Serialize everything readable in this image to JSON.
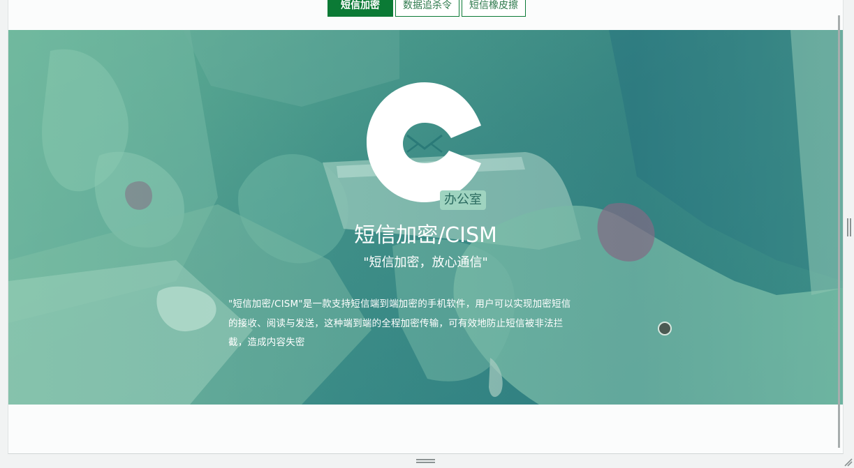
{
  "tabs": [
    {
      "label": "短信加密",
      "active": true
    },
    {
      "label": "数据追杀令",
      "active": false
    },
    {
      "label": "短信橡皮擦",
      "active": false
    }
  ],
  "hero": {
    "title": "短信加密/CISM",
    "subtitle": "\"短信加密，放心通信\"",
    "description_lines": [
      "\"短信加密/CISM\"是一款支持短信端到端加密的手机软件，用户可以实现加密短信",
      "的接收、阅读与发送，这种端到端的全程加密传输，可有效地防止短信被非法拦",
      "截，造成内容失密"
    ],
    "phone_label": "办公室"
  },
  "icons": {
    "logo": "envelope-c-logo-icon",
    "carousel_dot": "carousel-dot-icon",
    "side_grip": "resize-grip-icon",
    "bottom_grip": "resize-grip-icon",
    "corner_grip": "resize-corner-icon"
  },
  "colors": {
    "accent": "#0b7a35",
    "hero_tint": "#2a7a78",
    "text_on_hero": "#ffffff"
  }
}
